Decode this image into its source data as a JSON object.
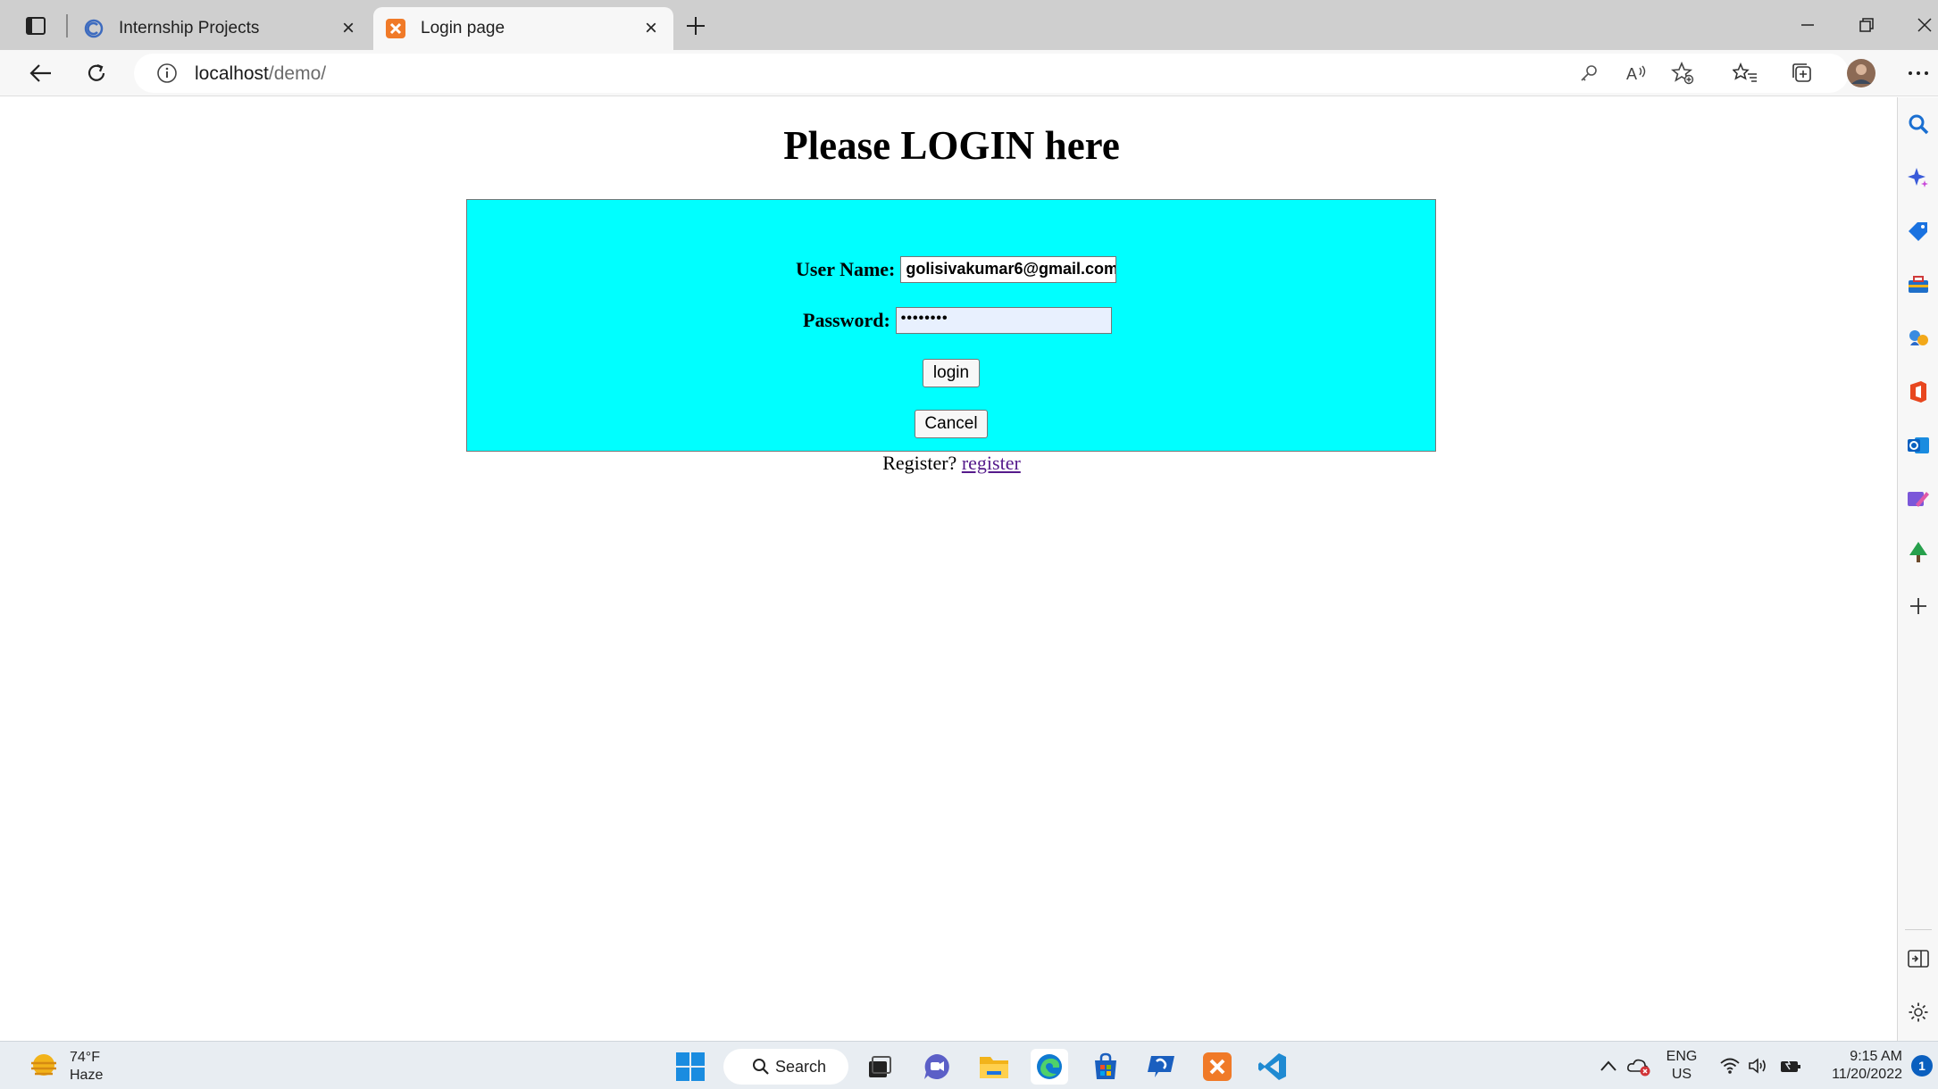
{
  "browser": {
    "tabs": [
      {
        "label": "Internship Projects",
        "active": false
      },
      {
        "label": "Login page",
        "active": true
      }
    ],
    "url_host": "localhost",
    "url_path": "/demo/"
  },
  "page": {
    "title": "Please LOGIN here",
    "form": {
      "username_label": "User Name:",
      "username_value": "golisivakumar6@gmail.com",
      "password_label": "Password:",
      "password_value": "••••••••",
      "login_label": "login",
      "cancel_label": "Cancel",
      "box_color": "#00ffff"
    },
    "register_prompt": "Register?",
    "register_link": "register"
  },
  "taskbar": {
    "weather_temp": "74°F",
    "weather_desc": "Haze",
    "search_label": "Search",
    "lang_top": "ENG",
    "lang_bottom": "US",
    "time": "9:15 AM",
    "date": "11/20/2022",
    "notification_count": "1"
  },
  "icons": {
    "sidebar": [
      "search-icon",
      "copilot-icon",
      "shopping-tag-icon",
      "tools-icon",
      "games-icon",
      "office-icon",
      "outlook-icon",
      "designer-icon",
      "tree-icon",
      "add-icon",
      "split-screen-icon",
      "settings-icon"
    ],
    "taskbar": [
      "windows-start-icon",
      "search-icon",
      "task-view-icon",
      "teams-chat-icon",
      "file-explorer-icon",
      "edge-icon",
      "store-icon",
      "app-icon",
      "xampp-icon",
      "vscode-icon"
    ]
  }
}
